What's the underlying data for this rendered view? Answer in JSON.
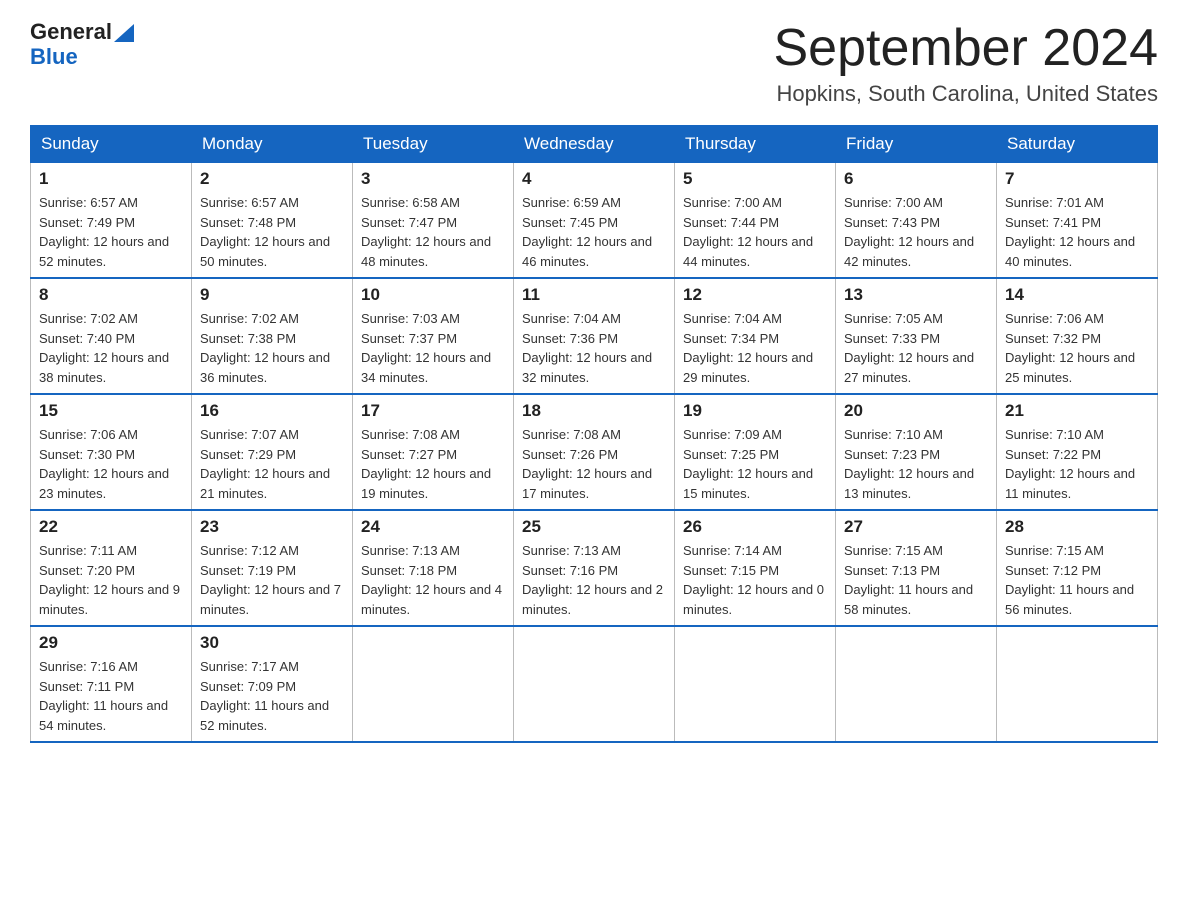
{
  "header": {
    "logo_line1": "General",
    "logo_line2": "Blue",
    "month_title": "September 2024",
    "location": "Hopkins, South Carolina, United States"
  },
  "weekdays": [
    "Sunday",
    "Monday",
    "Tuesday",
    "Wednesday",
    "Thursday",
    "Friday",
    "Saturday"
  ],
  "weeks": [
    [
      {
        "day": "1",
        "sunrise": "Sunrise: 6:57 AM",
        "sunset": "Sunset: 7:49 PM",
        "daylight": "Daylight: 12 hours and 52 minutes."
      },
      {
        "day": "2",
        "sunrise": "Sunrise: 6:57 AM",
        "sunset": "Sunset: 7:48 PM",
        "daylight": "Daylight: 12 hours and 50 minutes."
      },
      {
        "day": "3",
        "sunrise": "Sunrise: 6:58 AM",
        "sunset": "Sunset: 7:47 PM",
        "daylight": "Daylight: 12 hours and 48 minutes."
      },
      {
        "day": "4",
        "sunrise": "Sunrise: 6:59 AM",
        "sunset": "Sunset: 7:45 PM",
        "daylight": "Daylight: 12 hours and 46 minutes."
      },
      {
        "day": "5",
        "sunrise": "Sunrise: 7:00 AM",
        "sunset": "Sunset: 7:44 PM",
        "daylight": "Daylight: 12 hours and 44 minutes."
      },
      {
        "day": "6",
        "sunrise": "Sunrise: 7:00 AM",
        "sunset": "Sunset: 7:43 PM",
        "daylight": "Daylight: 12 hours and 42 minutes."
      },
      {
        "day": "7",
        "sunrise": "Sunrise: 7:01 AM",
        "sunset": "Sunset: 7:41 PM",
        "daylight": "Daylight: 12 hours and 40 minutes."
      }
    ],
    [
      {
        "day": "8",
        "sunrise": "Sunrise: 7:02 AM",
        "sunset": "Sunset: 7:40 PM",
        "daylight": "Daylight: 12 hours and 38 minutes."
      },
      {
        "day": "9",
        "sunrise": "Sunrise: 7:02 AM",
        "sunset": "Sunset: 7:38 PM",
        "daylight": "Daylight: 12 hours and 36 minutes."
      },
      {
        "day": "10",
        "sunrise": "Sunrise: 7:03 AM",
        "sunset": "Sunset: 7:37 PM",
        "daylight": "Daylight: 12 hours and 34 minutes."
      },
      {
        "day": "11",
        "sunrise": "Sunrise: 7:04 AM",
        "sunset": "Sunset: 7:36 PM",
        "daylight": "Daylight: 12 hours and 32 minutes."
      },
      {
        "day": "12",
        "sunrise": "Sunrise: 7:04 AM",
        "sunset": "Sunset: 7:34 PM",
        "daylight": "Daylight: 12 hours and 29 minutes."
      },
      {
        "day": "13",
        "sunrise": "Sunrise: 7:05 AM",
        "sunset": "Sunset: 7:33 PM",
        "daylight": "Daylight: 12 hours and 27 minutes."
      },
      {
        "day": "14",
        "sunrise": "Sunrise: 7:06 AM",
        "sunset": "Sunset: 7:32 PM",
        "daylight": "Daylight: 12 hours and 25 minutes."
      }
    ],
    [
      {
        "day": "15",
        "sunrise": "Sunrise: 7:06 AM",
        "sunset": "Sunset: 7:30 PM",
        "daylight": "Daylight: 12 hours and 23 minutes."
      },
      {
        "day": "16",
        "sunrise": "Sunrise: 7:07 AM",
        "sunset": "Sunset: 7:29 PM",
        "daylight": "Daylight: 12 hours and 21 minutes."
      },
      {
        "day": "17",
        "sunrise": "Sunrise: 7:08 AM",
        "sunset": "Sunset: 7:27 PM",
        "daylight": "Daylight: 12 hours and 19 minutes."
      },
      {
        "day": "18",
        "sunrise": "Sunrise: 7:08 AM",
        "sunset": "Sunset: 7:26 PM",
        "daylight": "Daylight: 12 hours and 17 minutes."
      },
      {
        "day": "19",
        "sunrise": "Sunrise: 7:09 AM",
        "sunset": "Sunset: 7:25 PM",
        "daylight": "Daylight: 12 hours and 15 minutes."
      },
      {
        "day": "20",
        "sunrise": "Sunrise: 7:10 AM",
        "sunset": "Sunset: 7:23 PM",
        "daylight": "Daylight: 12 hours and 13 minutes."
      },
      {
        "day": "21",
        "sunrise": "Sunrise: 7:10 AM",
        "sunset": "Sunset: 7:22 PM",
        "daylight": "Daylight: 12 hours and 11 minutes."
      }
    ],
    [
      {
        "day": "22",
        "sunrise": "Sunrise: 7:11 AM",
        "sunset": "Sunset: 7:20 PM",
        "daylight": "Daylight: 12 hours and 9 minutes."
      },
      {
        "day": "23",
        "sunrise": "Sunrise: 7:12 AM",
        "sunset": "Sunset: 7:19 PM",
        "daylight": "Daylight: 12 hours and 7 minutes."
      },
      {
        "day": "24",
        "sunrise": "Sunrise: 7:13 AM",
        "sunset": "Sunset: 7:18 PM",
        "daylight": "Daylight: 12 hours and 4 minutes."
      },
      {
        "day": "25",
        "sunrise": "Sunrise: 7:13 AM",
        "sunset": "Sunset: 7:16 PM",
        "daylight": "Daylight: 12 hours and 2 minutes."
      },
      {
        "day": "26",
        "sunrise": "Sunrise: 7:14 AM",
        "sunset": "Sunset: 7:15 PM",
        "daylight": "Daylight: 12 hours and 0 minutes."
      },
      {
        "day": "27",
        "sunrise": "Sunrise: 7:15 AM",
        "sunset": "Sunset: 7:13 PM",
        "daylight": "Daylight: 11 hours and 58 minutes."
      },
      {
        "day": "28",
        "sunrise": "Sunrise: 7:15 AM",
        "sunset": "Sunset: 7:12 PM",
        "daylight": "Daylight: 11 hours and 56 minutes."
      }
    ],
    [
      {
        "day": "29",
        "sunrise": "Sunrise: 7:16 AM",
        "sunset": "Sunset: 7:11 PM",
        "daylight": "Daylight: 11 hours and 54 minutes."
      },
      {
        "day": "30",
        "sunrise": "Sunrise: 7:17 AM",
        "sunset": "Sunset: 7:09 PM",
        "daylight": "Daylight: 11 hours and 52 minutes."
      },
      null,
      null,
      null,
      null,
      null
    ]
  ]
}
